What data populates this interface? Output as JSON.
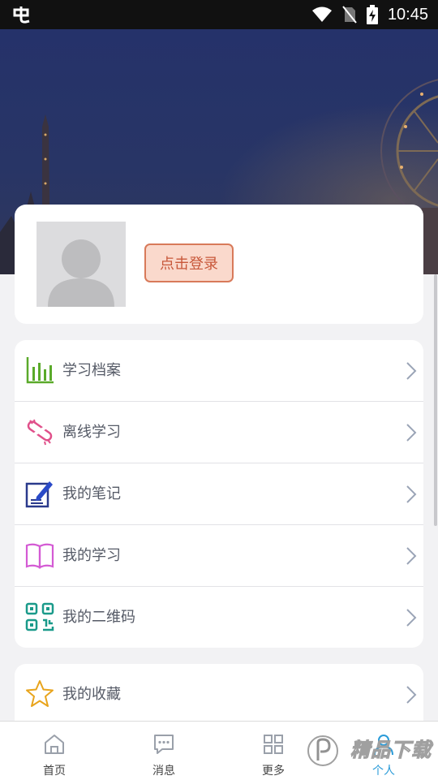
{
  "status_bar": {
    "time": "10:45",
    "icons": [
      "app-logo-icon",
      "wifi-icon",
      "no-sim-icon",
      "battery-charging-icon"
    ]
  },
  "profile": {
    "login_label": "点击登录"
  },
  "menu": [
    {
      "label": "学习档案",
      "icon": "bar-chart-icon"
    },
    {
      "label": "离线学习",
      "icon": "offline-link-icon"
    },
    {
      "label": "我的笔记",
      "icon": "notes-pen-icon"
    },
    {
      "label": "我的学习",
      "icon": "open-book-icon"
    },
    {
      "label": "我的二维码",
      "icon": "qr-code-icon"
    }
  ],
  "menu2": [
    {
      "label": "我的收藏",
      "icon": "star-icon"
    }
  ],
  "tabs": [
    {
      "label": "首页",
      "icon": "home-icon"
    },
    {
      "label": "消息",
      "icon": "message-icon"
    },
    {
      "label": "更多",
      "icon": "grid-icon"
    },
    {
      "label": "个人",
      "icon": "person-icon",
      "active": true
    }
  ],
  "watermark": {
    "text": "精品下载"
  },
  "colors": {
    "accent": "#2a9bd8",
    "login_bg": "#fad9cc",
    "login_border": "#d87a5a",
    "banner": "#283566"
  }
}
